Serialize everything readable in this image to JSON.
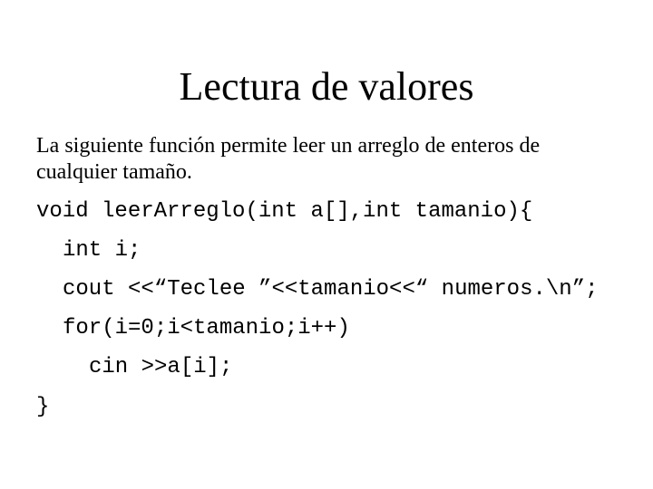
{
  "slide": {
    "title": "Lectura de valores",
    "intro_line1": "La siguiente función permite leer un arreglo de enteros de",
    "intro_line2": "cualquier tamaño.",
    "code": [
      "void leerArreglo(int a[],int tamanio){",
      "int i;",
      "cout <<“Teclee ”<<tamanio<<“ numeros.\\n”;",
      "for(i=0;i<tamanio;i++)",
      "cin >>a[i];",
      "}"
    ]
  }
}
